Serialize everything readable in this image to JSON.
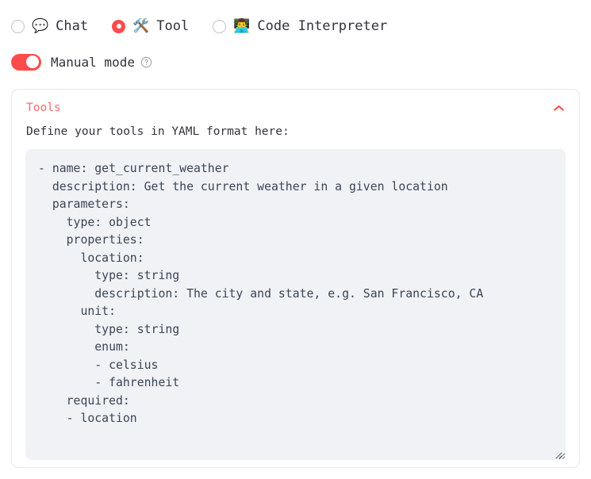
{
  "mode_selector": {
    "options": [
      {
        "label": "Chat",
        "emoji": "💬",
        "icon_name": "speech-balloon-icon",
        "selected": false
      },
      {
        "label": "Tool",
        "emoji": "🛠️",
        "icon_name": "hammer-and-wrench-icon",
        "selected": true
      },
      {
        "label": "Code Interpreter",
        "emoji": "👨‍💻",
        "icon_name": "technologist-icon",
        "selected": false
      }
    ]
  },
  "manual_mode": {
    "label": "Manual mode",
    "enabled": true,
    "help_icon": "question-mark-circle-icon"
  },
  "tools_card": {
    "title": "Tools",
    "collapse_icon": "chevron-up-icon",
    "expanded": true,
    "description": "Define your tools in YAML format here:",
    "yaml_value": "- name: get_current_weather\n  description: Get the current weather in a given location\n  parameters:\n    type: object\n    properties:\n      location:\n        type: string\n        description: The city and state, e.g. San Francisco, CA\n      unit:\n        type: string\n        enum:\n        - celsius\n        - fahrenheit\n    required:\n    - location",
    "yaml_placeholder": "Define your tools in YAML format here:",
    "resize_handle": "resize-grip-icon"
  },
  "colors": {
    "accent": "#ff4b4b",
    "title": "#ff6a6a",
    "text": "#31333f",
    "code_text": "#3b4555",
    "code_bg": "#f0f2f6",
    "card_border": "#e6e8eb",
    "radio_border": "#bfc4cd"
  }
}
